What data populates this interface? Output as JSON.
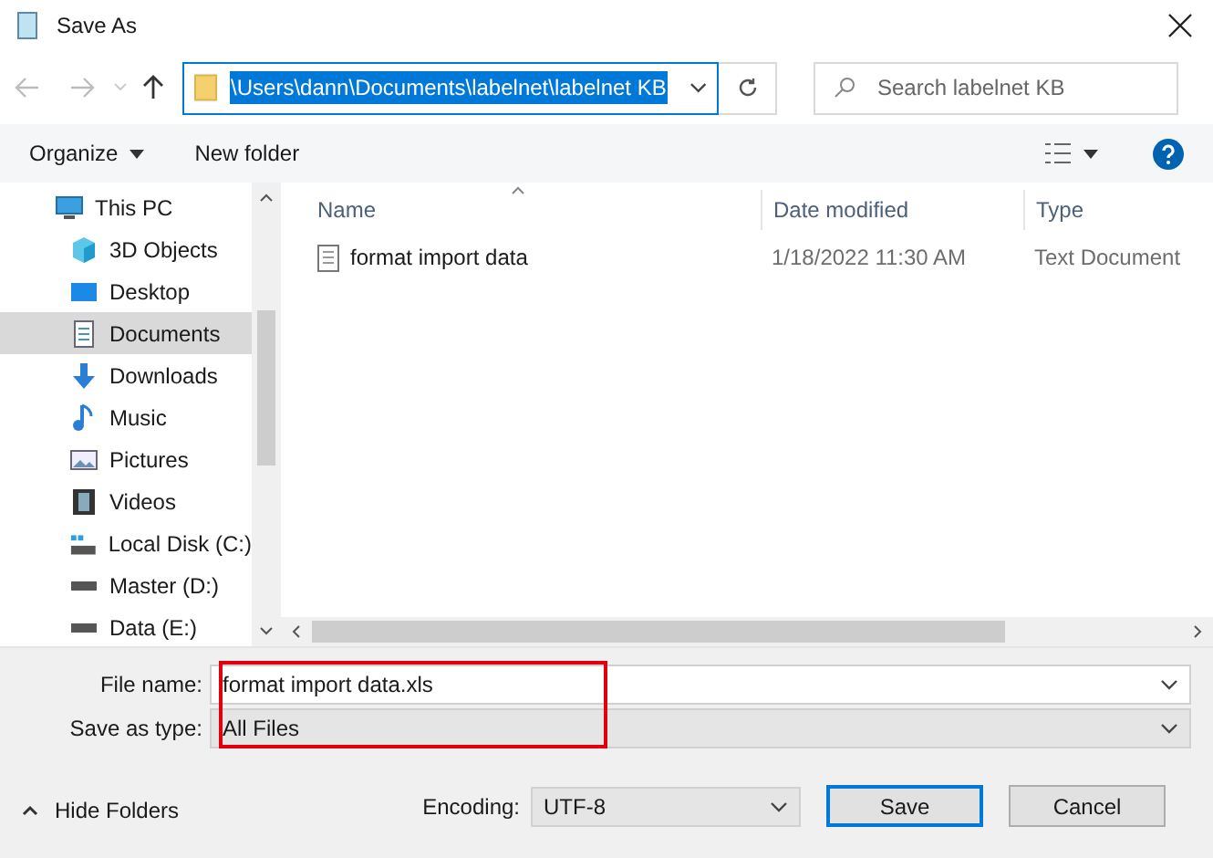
{
  "window": {
    "title": "Save As"
  },
  "address": {
    "path": "\\Users\\dann\\Documents\\labelnet\\labelnet KB",
    "selected": true
  },
  "search": {
    "placeholder": "Search labelnet KB"
  },
  "toolbar": {
    "organize": "Organize",
    "new_folder": "New folder"
  },
  "sidebar": {
    "items": [
      {
        "label": "This PC",
        "kind": "pc",
        "selected": false,
        "children": [
          {
            "label": "3D Objects",
            "kind": "cube",
            "selected": false
          },
          {
            "label": "Desktop",
            "kind": "desktop",
            "selected": false
          },
          {
            "label": "Documents",
            "kind": "document",
            "selected": true
          },
          {
            "label": "Downloads",
            "kind": "download",
            "selected": false
          },
          {
            "label": "Music",
            "kind": "music",
            "selected": false
          },
          {
            "label": "Pictures",
            "kind": "pictures",
            "selected": false
          },
          {
            "label": "Videos",
            "kind": "videos",
            "selected": false
          },
          {
            "label": "Local Disk (C:)",
            "kind": "disk",
            "selected": false
          },
          {
            "label": "Master (D:)",
            "kind": "drive",
            "selected": false
          },
          {
            "label": "Data (E:)",
            "kind": "drive",
            "selected": false
          }
        ]
      }
    ]
  },
  "table": {
    "columns": [
      "Name",
      "Date modified",
      "Type"
    ],
    "rows": [
      {
        "name": "format import data",
        "date": "1/18/2022 11:30 AM",
        "type": "Text Document",
        "selected": false
      }
    ]
  },
  "form": {
    "file_name_label": "File name:",
    "file_name": "format import data.xls",
    "type_label": "Save as type:",
    "type": "All Files"
  },
  "footer": {
    "hide_folders": "Hide Folders",
    "encoding_label": "Encoding:",
    "encoding": "UTF-8",
    "save": "Save",
    "cancel": "Cancel"
  }
}
